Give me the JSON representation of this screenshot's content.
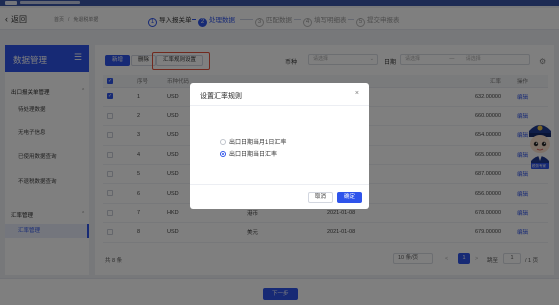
{
  "header": {
    "back_label": "返回",
    "breadcrumb": [
      "首页",
      "免退税单据"
    ],
    "steps": [
      {
        "num": "1",
        "label": "导入报关单",
        "state": "done"
      },
      {
        "num": "2",
        "label": "处理数据",
        "state": "active"
      },
      {
        "num": "3",
        "label": "匹配数据",
        "state": "todo"
      },
      {
        "num": "4",
        "label": "填写明细表",
        "state": "todo"
      },
      {
        "num": "5",
        "label": "提交申报表",
        "state": "todo"
      }
    ]
  },
  "sidebar": {
    "title": "数据管理",
    "sections": [
      {
        "title": "出口报关单管理",
        "items": [
          "待处理数据",
          "无电子信息",
          "已使用数据查询",
          "不退税数据查询"
        ]
      },
      {
        "title": "汇率管理",
        "items": [
          "汇率管理"
        ]
      }
    ],
    "active_item": "汇率管理"
  },
  "toolbar": {
    "new_label": "新增",
    "delete_label": "删除",
    "rate_rule_label": "汇率规则设置",
    "currency_label": "币种",
    "currency_placeholder": "请选择",
    "date_label": "日期",
    "date_start_placeholder": "请选择",
    "date_to": "—",
    "date_end_placeholder": "请选择"
  },
  "table": {
    "columns": [
      "",
      "序号",
      "币种代码",
      "",
      "",
      "汇率",
      "操作"
    ],
    "rows": [
      {
        "checked": true,
        "seq": "1",
        "code": "USD",
        "name": "",
        "date": "",
        "rate": "632.00000",
        "op": "编辑"
      },
      {
        "checked": false,
        "seq": "2",
        "code": "USD",
        "name": "",
        "date": "",
        "rate": "660.00000",
        "op": "编辑"
      },
      {
        "checked": false,
        "seq": "3",
        "code": "USD",
        "name": "",
        "date": "",
        "rate": "654.00000",
        "op": "编辑"
      },
      {
        "checked": false,
        "seq": "4",
        "code": "USD",
        "name": "",
        "date": "",
        "rate": "665.00000",
        "op": "编辑"
      },
      {
        "checked": false,
        "seq": "5",
        "code": "USD",
        "name": "",
        "date": "",
        "rate": "687.00000",
        "op": "编辑"
      },
      {
        "checked": false,
        "seq": "6",
        "code": "USD",
        "name": "",
        "date": "",
        "rate": "656.00000",
        "op": "编辑"
      },
      {
        "checked": false,
        "seq": "7",
        "code": "HKD",
        "name": "港币",
        "date": "2021-01-08",
        "rate": "678.00000",
        "op": "编辑"
      },
      {
        "checked": false,
        "seq": "8",
        "code": "USD",
        "name": "美元",
        "date": "2021-01-08",
        "rate": "679.00000",
        "op": "编辑"
      }
    ]
  },
  "pager": {
    "total": "共 8 条",
    "page_size": "10 条/页",
    "prev": "<",
    "current": "1",
    "next": ">",
    "goto_label": "跳至",
    "goto_value": "1",
    "page_total": "/ 1 页"
  },
  "footer": {
    "next_label": "下一步"
  },
  "modal": {
    "title": "设置汇率规则",
    "close": "×",
    "options": [
      {
        "label": "出口日期当月1日汇率",
        "selected": false
      },
      {
        "label": "出口日期当日汇率",
        "selected": true
      }
    ],
    "cancel_label": "取消",
    "ok_label": "确定"
  },
  "mascot": {
    "badge": "税务专家"
  },
  "colors": {
    "primary": "#2f54eb",
    "highlight": "#e2533d",
    "header": "#3a56a8"
  }
}
